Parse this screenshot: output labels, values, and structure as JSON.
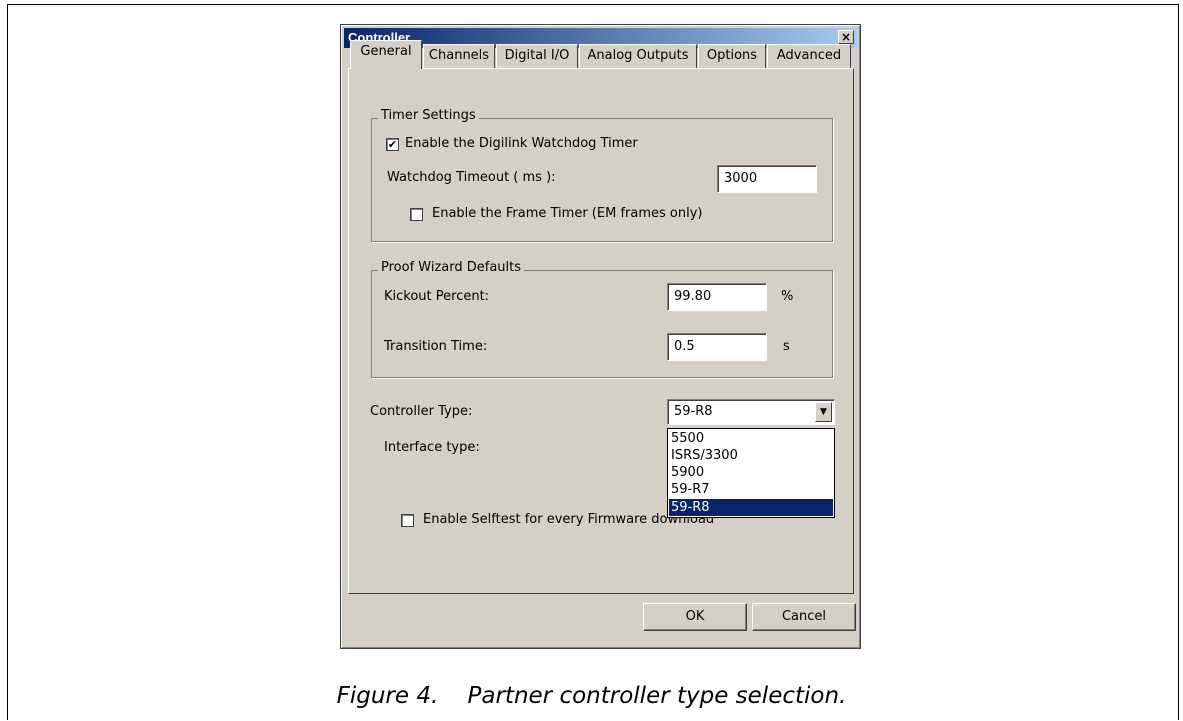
{
  "dialog": {
    "title": "Controller",
    "close_icon": "×"
  },
  "tabs": [
    {
      "label": "General",
      "active": true
    },
    {
      "label": "Channels"
    },
    {
      "label": "Digital I/O"
    },
    {
      "label": "Analog Outputs"
    },
    {
      "label": "Options"
    },
    {
      "label": "Advanced"
    }
  ],
  "timer_settings": {
    "legend": "Timer Settings",
    "watchdog_checkbox": {
      "label": "Enable the Digilink Watchdog Timer",
      "checked": true,
      "check_mark": "✔"
    },
    "watchdog_timeout": {
      "label": "Watchdog Timeout ( ms ):",
      "value": "3000"
    },
    "frame_timer_checkbox": {
      "label": "Enable the Frame Timer (EM frames only)",
      "checked": false
    }
  },
  "proof_wizard": {
    "legend": "Proof Wizard Defaults",
    "kickout_percent": {
      "label": "Kickout Percent:",
      "value": "99.80",
      "unit": "%"
    },
    "transition_time": {
      "label": "Transition Time:",
      "value": "0.5",
      "unit": "s"
    }
  },
  "controller_type": {
    "label": "Controller Type:",
    "selected": "59-R8",
    "dropdown_icon": "▼",
    "options": [
      "5500",
      "ISRS/3300",
      "5900",
      "59-R7",
      "59-R8"
    ]
  },
  "interface_type": {
    "label": "Interface type:"
  },
  "selftest_checkbox": {
    "label": "Enable Selftest for every Firmware download",
    "checked": false
  },
  "buttons": {
    "ok": "OK",
    "cancel": "Cancel"
  },
  "caption": "Figure 4.    Partner controller type selection."
}
